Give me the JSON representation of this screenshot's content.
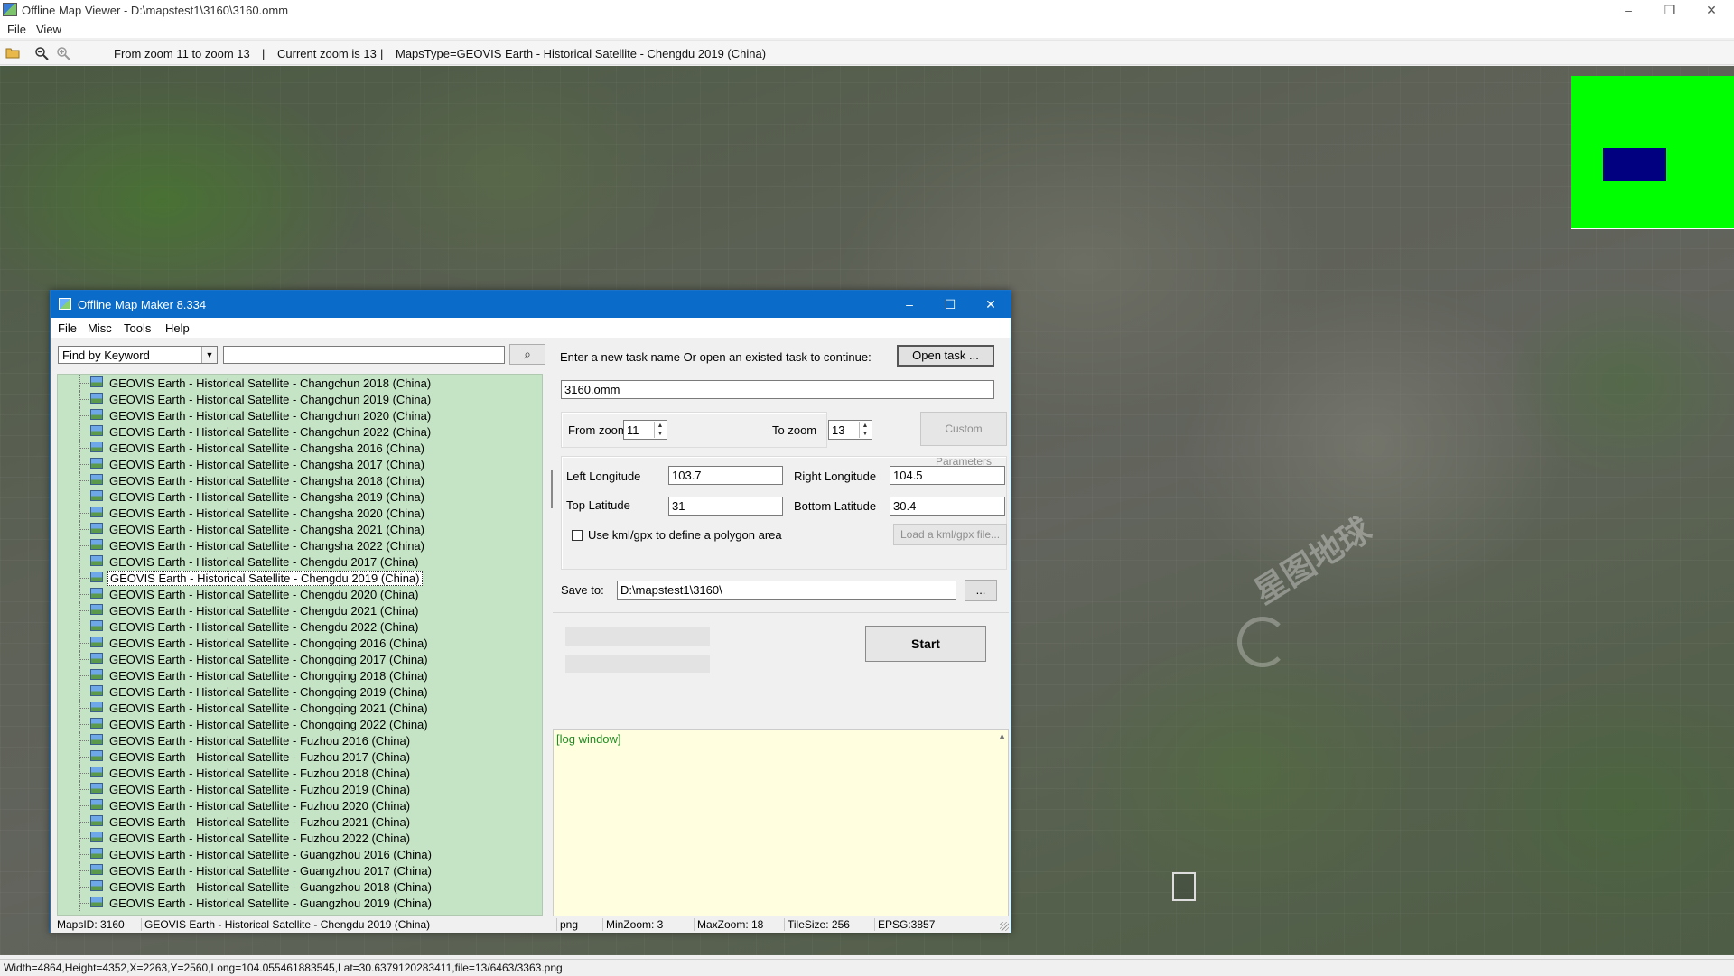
{
  "main_window": {
    "title": "Offline Map Viewer - D:\\mapstest1\\3160\\3160.omm",
    "controls": {
      "minimize": "–",
      "restore": "❐",
      "close": "✕"
    }
  },
  "menu": {
    "file": "File",
    "view": "View"
  },
  "toolbar": {
    "icons": [
      "open-folder-icon",
      "zoom-out-icon",
      "zoom-in-icon"
    ],
    "zoom_range": "From zoom 11 to zoom 13",
    "separator": "|",
    "current_zoom": "Current zoom is 13",
    "maps_type": "MapsType=GEOVIS Earth - Historical Satellite - Chengdu 2019 (China)"
  },
  "map": {
    "watermark": "星图地球",
    "minimap_colors": {
      "background": "#00ff00",
      "viewport": "#000080"
    }
  },
  "status_bar": {
    "text": "Width=4864,Height=4352,X=2263,Y=2560,Long=104.055461883545,Lat=30.6379120283411,file=13/6463/3363.png"
  },
  "dialog": {
    "title": "Offline Map Maker 8.334",
    "menu": {
      "file": "File",
      "misc": "Misc",
      "tools": "Tools",
      "help": "Help"
    },
    "search": {
      "mode": "Find by Keyword",
      "query": "",
      "button_icon": "search-icon"
    },
    "tree_items": [
      "GEOVIS Earth - Historical Satellite - Changchun 2018 (China)",
      "GEOVIS Earth - Historical Satellite - Changchun 2019 (China)",
      "GEOVIS Earth - Historical Satellite - Changchun 2020 (China)",
      "GEOVIS Earth - Historical Satellite - Changchun 2022 (China)",
      "GEOVIS Earth - Historical Satellite - Changsha 2016 (China)",
      "GEOVIS Earth - Historical Satellite - Changsha 2017 (China)",
      "GEOVIS Earth - Historical Satellite - Changsha 2018 (China)",
      "GEOVIS Earth - Historical Satellite - Changsha 2019 (China)",
      "GEOVIS Earth - Historical Satellite - Changsha 2020 (China)",
      "GEOVIS Earth - Historical Satellite - Changsha 2021 (China)",
      "GEOVIS Earth - Historical Satellite - Changsha 2022 (China)",
      "GEOVIS Earth - Historical Satellite - Chengdu 2017 (China)",
      "GEOVIS Earth - Historical Satellite - Chengdu 2019 (China)",
      "GEOVIS Earth - Historical Satellite - Chengdu 2020 (China)",
      "GEOVIS Earth - Historical Satellite - Chengdu 2021 (China)",
      "GEOVIS Earth - Historical Satellite - Chengdu 2022 (China)",
      "GEOVIS Earth - Historical Satellite - Chongqing 2016 (China)",
      "GEOVIS Earth - Historical Satellite - Chongqing 2017 (China)",
      "GEOVIS Earth - Historical Satellite - Chongqing 2018 (China)",
      "GEOVIS Earth - Historical Satellite - Chongqing 2019 (China)",
      "GEOVIS Earth - Historical Satellite - Chongqing 2021 (China)",
      "GEOVIS Earth - Historical Satellite - Chongqing 2022 (China)",
      "GEOVIS Earth - Historical Satellite - Fuzhou 2016 (China)",
      "GEOVIS Earth - Historical Satellite - Fuzhou 2017 (China)",
      "GEOVIS Earth - Historical Satellite - Fuzhou 2018 (China)",
      "GEOVIS Earth - Historical Satellite - Fuzhou 2019 (China)",
      "GEOVIS Earth - Historical Satellite - Fuzhou 2020 (China)",
      "GEOVIS Earth - Historical Satellite - Fuzhou 2021 (China)",
      "GEOVIS Earth - Historical Satellite - Fuzhou 2022 (China)",
      "GEOVIS Earth - Historical Satellite - Guangzhou 2016 (China)",
      "GEOVIS Earth - Historical Satellite - Guangzhou 2017 (China)",
      "GEOVIS Earth - Historical Satellite - Guangzhou 2018 (China)",
      "GEOVIS Earth - Historical Satellite - Guangzhou 2019 (China)"
    ],
    "selected_item": "GEOVIS Earth - Historical Satellite - Chengdu 2019 (China)",
    "task": {
      "prompt": "Enter a new task name Or open an existed task to continue:",
      "open_button": "Open task ...",
      "name_value": "3160.omm"
    },
    "zoom": {
      "from_label": "From zoom",
      "from_value": "11",
      "to_label": "To zoom",
      "to_value": "13",
      "custom_button": "Custom Parameters"
    },
    "bounds": {
      "left_lon_label": "Left Longitude",
      "left_lon_value": "103.7",
      "right_lon_label": "Right Longitude",
      "right_lon_value": "104.5",
      "top_lat_label": "Top Latitude",
      "top_lat_value": "31",
      "bottom_lat_label": "Bottom Latitude",
      "bottom_lat_value": "30.4",
      "kml_checkbox_label": "Use kml/gpx to define a polygon area",
      "kml_checked": false,
      "load_kml_button": "Load a kml/gpx file..."
    },
    "save": {
      "label": "Save to:",
      "path": "D:\\mapstest1\\3160\\",
      "browse_button": "..."
    },
    "start_button": "Start",
    "log_text": "[log window]",
    "status": {
      "maps_id": "MapsID: 3160",
      "maps_name": "GEOVIS Earth - Historical Satellite - Chengdu 2019 (China)",
      "format": "png",
      "min_zoom": "MinZoom: 3",
      "max_zoom": "MaxZoom: 18",
      "tile_size": "TileSize: 256",
      "epsg": "EPSG:3857"
    },
    "controls": {
      "minimize": "–",
      "maximize": "☐",
      "close": "✕"
    }
  }
}
